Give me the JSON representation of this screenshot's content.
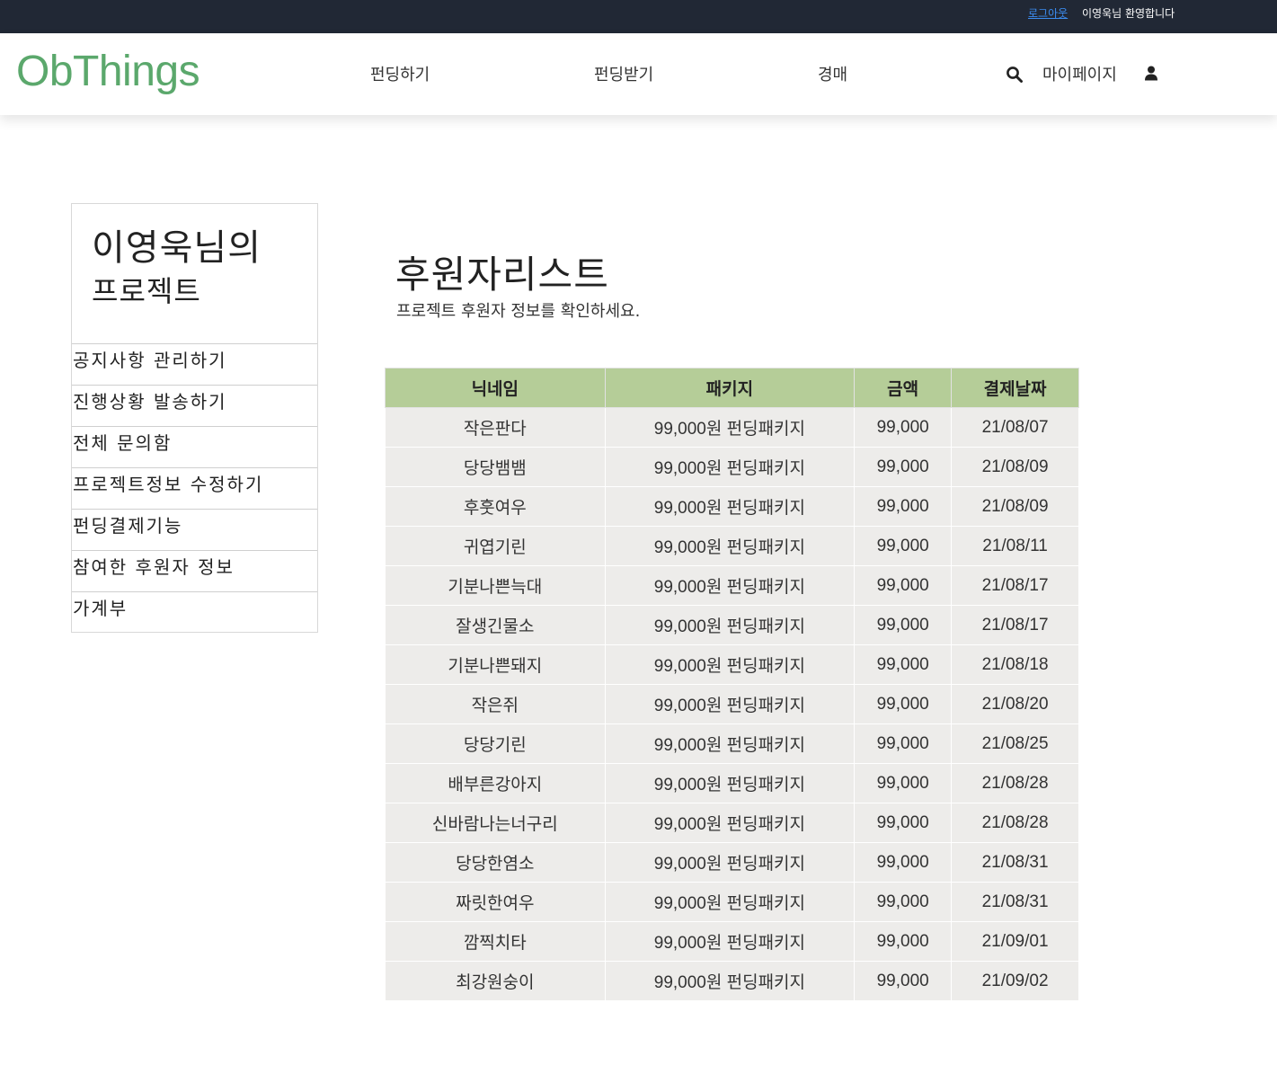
{
  "topbar": {
    "logout": "로그아웃",
    "welcome": "이영욱님 환영합니다"
  },
  "header": {
    "logo": "ObThings",
    "nav": [
      "펀딩하기",
      "펀딩받기",
      "경매"
    ],
    "mypage": "마이페이지",
    "icons": [
      "search-icon",
      "user-icon"
    ]
  },
  "sidebar": {
    "title_line1": "이영욱님의",
    "title_line2": "프로젝트",
    "items": [
      "공지사항 관리하기",
      "진행상황 발송하기",
      "전체 문의함",
      "프로젝트정보 수정하기",
      "펀딩결제기능",
      "참여한 후원자 정보",
      "가계부"
    ]
  },
  "main": {
    "title": "후원자리스트",
    "subtitle": "프로젝트 후원자 정보를 확인하세요."
  },
  "table": {
    "headers": [
      "닉네임",
      "패키지",
      "금액",
      "결제날짜"
    ],
    "rows": [
      [
        "작은판다",
        "99,000원 펀딩패키지",
        "99,000",
        "21/08/07"
      ],
      [
        "당당뱀뱀",
        "99,000원 펀딩패키지",
        "99,000",
        "21/08/09"
      ],
      [
        "후훗여우",
        "99,000원 펀딩패키지",
        "99,000",
        "21/08/09"
      ],
      [
        "귀엽기린",
        "99,000원 펀딩패키지",
        "99,000",
        "21/08/11"
      ],
      [
        "기분나쁜늑대",
        "99,000원 펀딩패키지",
        "99,000",
        "21/08/17"
      ],
      [
        "잘생긴물소",
        "99,000원 펀딩패키지",
        "99,000",
        "21/08/17"
      ],
      [
        "기분나쁜돼지",
        "99,000원 펀딩패키지",
        "99,000",
        "21/08/18"
      ],
      [
        "작은쥐",
        "99,000원 펀딩패키지",
        "99,000",
        "21/08/20"
      ],
      [
        "당당기린",
        "99,000원 펀딩패키지",
        "99,000",
        "21/08/25"
      ],
      [
        "배부른강아지",
        "99,000원 펀딩패키지",
        "99,000",
        "21/08/28"
      ],
      [
        "신바람나는너구리",
        "99,000원 펀딩패키지",
        "99,000",
        "21/08/28"
      ],
      [
        "당당한염소",
        "99,000원 펀딩패키지",
        "99,000",
        "21/08/31"
      ],
      [
        "짜릿한여우",
        "99,000원 펀딩패키지",
        "99,000",
        "21/08/31"
      ],
      [
        "깜찍치타",
        "99,000원 펀딩패키지",
        "99,000",
        "21/09/01"
      ],
      [
        "최강원숭이",
        "99,000원 펀딩패키지",
        "99,000",
        "21/09/02"
      ]
    ]
  },
  "colors": {
    "topbar": "#212835",
    "logo": "#5ba86c",
    "table_header": "#b5cd98",
    "table_cell": "#edecea",
    "link": "#3b8cf0"
  }
}
